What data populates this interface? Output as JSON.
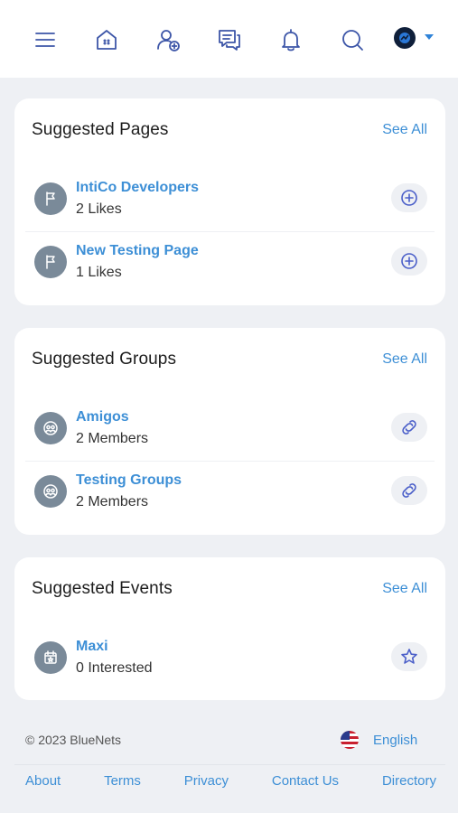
{
  "topbar": {
    "icons": [
      "menu-icon",
      "home-icon",
      "add-friend-icon",
      "messages-icon",
      "notifications-icon",
      "search-icon",
      "avatar",
      "chevron-down-icon"
    ]
  },
  "pages": {
    "title": "Suggested Pages",
    "see_all": "See All",
    "items": [
      {
        "name": "IntiCo Developers",
        "sub": "2 Likes"
      },
      {
        "name": "New Testing Page",
        "sub": "1 Likes"
      }
    ]
  },
  "groups": {
    "title": "Suggested Groups",
    "see_all": "See All",
    "items": [
      {
        "name": "Amigos",
        "sub": "2 Members"
      },
      {
        "name": "Testing Groups",
        "sub": "2 Members"
      }
    ]
  },
  "events": {
    "title": "Suggested Events",
    "see_all": "See All",
    "items": [
      {
        "name": "Maxi",
        "sub": "0 Interested"
      }
    ]
  },
  "footer": {
    "copyright": "© 2023 BlueNets",
    "language": "English",
    "links": [
      "About",
      "Terms",
      "Privacy",
      "Contact Us",
      "Directory"
    ]
  },
  "colors": {
    "accent": "#3d8fd6",
    "icon": "#3d56a8",
    "background": "#eef0f4"
  }
}
